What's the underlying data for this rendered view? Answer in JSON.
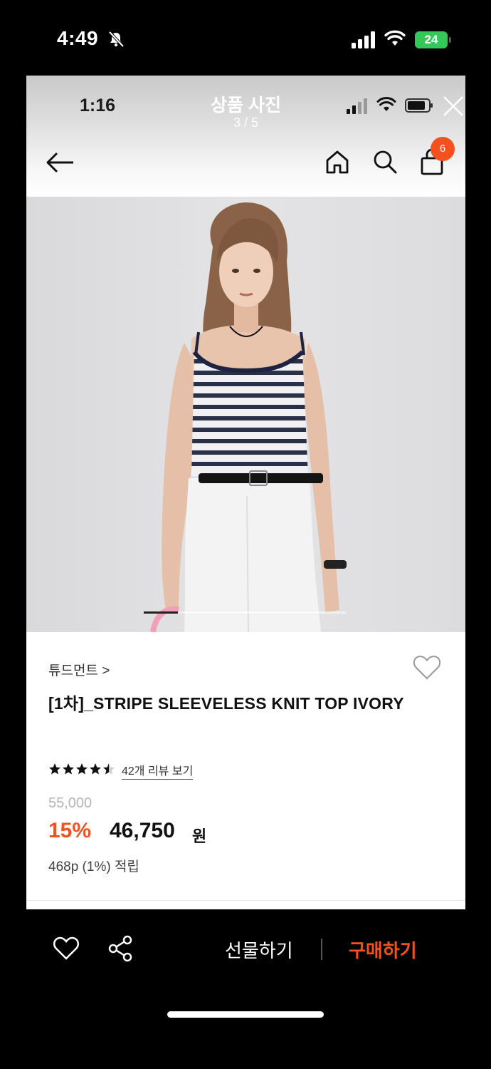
{
  "status_bar": {
    "time": "4:49",
    "battery": "24"
  },
  "viewer": {
    "time": "1:16",
    "title": "상품 사진",
    "counter": "3 / 5"
  },
  "header": {
    "cart_count": "6"
  },
  "gallery": {
    "current_index": 3,
    "total": 5
  },
  "product": {
    "brand": "튜드먼트 >",
    "name": "[1차]_STRIPE SLEEVELESS KNIT TOP IVORY",
    "rating": 4.5,
    "review_link": "42개 리뷰 보기",
    "original_price": "55,000",
    "discount": "15%",
    "sale_price": "46,750",
    "currency": "원",
    "points": "468p (1%) 적립"
  },
  "bottom_bar": {
    "gift_label": "선물하기",
    "buy_label": "구매하기"
  },
  "colors": {
    "accent": "#f4511e",
    "background": "#000000",
    "card": "#ffffff"
  }
}
